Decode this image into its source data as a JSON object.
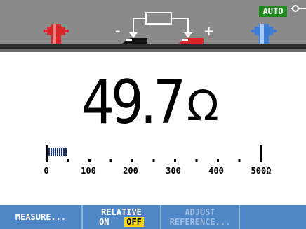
{
  "header": {
    "auto_badge": "AUTO",
    "icons": [
      "red-probe-jack-icon",
      "resistor-schematic-icon",
      "blue-probe-jack-icon",
      "connector-plug-icon"
    ],
    "minus_label": "-",
    "plus_label": "+"
  },
  "reading": {
    "value": "49.7",
    "unit": "Ω"
  },
  "bargraph": {
    "fill_fraction": 0.099,
    "tick_labels": [
      "0",
      "100",
      "200",
      "300",
      "400",
      "500Ω"
    ]
  },
  "softkeys": {
    "measure": "MEASURE...",
    "relative_title": "RELATIVE",
    "relative_on": "ON",
    "relative_off": "OFF",
    "adjust_line1": "ADJUST",
    "adjust_line2": "REFERENCE..."
  },
  "colors": {
    "header_gray": "#8a8a8a",
    "softkey_blue": "#4f86c6",
    "auto_green": "#1c8a1c",
    "off_yellow": "#f5d800",
    "probe_red": "#d8262a",
    "probe_blue": "#3a7bd5"
  }
}
